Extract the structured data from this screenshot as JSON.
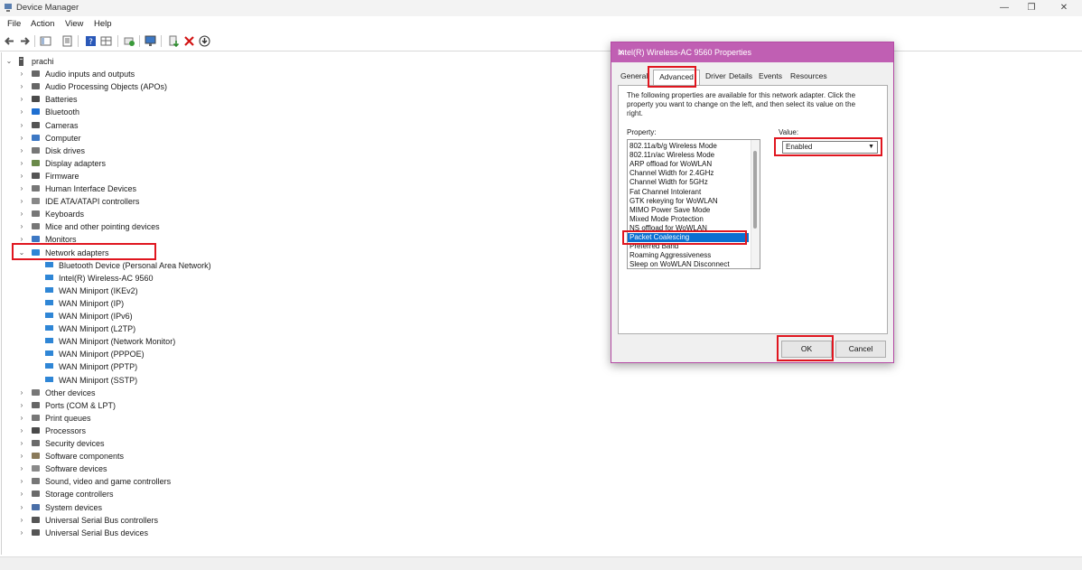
{
  "window": {
    "title": "Device Manager",
    "controls": [
      "—",
      "❐",
      "✕"
    ]
  },
  "menu": [
    "File",
    "Action",
    "View",
    "Help"
  ],
  "tree": {
    "root": "prachi",
    "categories": [
      {
        "label": "Audio inputs and outputs",
        "icon": "speaker-icon"
      },
      {
        "label": "Audio Processing Objects (APOs)",
        "icon": "speaker-icon"
      },
      {
        "label": "Batteries",
        "icon": "battery-icon"
      },
      {
        "label": "Bluetooth",
        "icon": "bluetooth-icon"
      },
      {
        "label": "Cameras",
        "icon": "camera-icon"
      },
      {
        "label": "Computer",
        "icon": "monitor-icon"
      },
      {
        "label": "Disk drives",
        "icon": "disk-icon"
      },
      {
        "label": "Display adapters",
        "icon": "display-adapter-icon"
      },
      {
        "label": "Firmware",
        "icon": "firmware-icon"
      },
      {
        "label": "Human Interface Devices",
        "icon": "hid-icon"
      },
      {
        "label": "IDE ATA/ATAPI controllers",
        "icon": "ide-icon"
      },
      {
        "label": "Keyboards",
        "icon": "keyboard-icon"
      },
      {
        "label": "Mice and other pointing devices",
        "icon": "mouse-icon"
      },
      {
        "label": "Monitors",
        "icon": "monitor-icon"
      },
      {
        "label": "Network adapters",
        "icon": "network-adapter-icon",
        "expanded": true,
        "children": [
          "Bluetooth Device (Personal Area Network)",
          "Intel(R) Wireless-AC 9560",
          "WAN Miniport (IKEv2)",
          "WAN Miniport (IP)",
          "WAN Miniport (IPv6)",
          "WAN Miniport (L2TP)",
          "WAN Miniport (Network Monitor)",
          "WAN Miniport (PPPOE)",
          "WAN Miniport (PPTP)",
          "WAN Miniport (SSTP)"
        ]
      },
      {
        "label": "Other devices",
        "icon": "other-devices-icon"
      },
      {
        "label": "Ports (COM & LPT)",
        "icon": "port-icon"
      },
      {
        "label": "Print queues",
        "icon": "printer-icon"
      },
      {
        "label": "Processors",
        "icon": "processor-icon"
      },
      {
        "label": "Security devices",
        "icon": "security-icon"
      },
      {
        "label": "Software components",
        "icon": "software-component-icon"
      },
      {
        "label": "Software devices",
        "icon": "software-device-icon"
      },
      {
        "label": "Sound, video and game controllers",
        "icon": "sound-icon"
      },
      {
        "label": "Storage controllers",
        "icon": "storage-icon"
      },
      {
        "label": "System devices",
        "icon": "system-device-icon"
      },
      {
        "label": "Universal Serial Bus controllers",
        "icon": "usb-icon"
      },
      {
        "label": "Universal Serial Bus devices",
        "icon": "usb-icon"
      }
    ]
  },
  "dialog": {
    "title": "Intel(R) Wireless-AC 9560 Properties",
    "close": "✕",
    "tabs": [
      "General",
      "Advanced",
      "Driver",
      "Details",
      "Events",
      "Resources"
    ],
    "active_tab": "Advanced",
    "description": "The following properties are available for this network adapter. Click the property you want to change on the left, and then select its value on the right.",
    "property_label": "Property:",
    "value_label": "Value:",
    "properties": [
      "802.11a/b/g Wireless Mode",
      "802.11n/ac Wireless Mode",
      "ARP offload for WoWLAN",
      "Channel Width for 2.4GHz",
      "Channel Width for 5GHz",
      "Fat Channel Intolerant",
      "GTK rekeying for WoWLAN",
      "MIMO Power Save Mode",
      "Mixed Mode Protection",
      "NS offload for WoWLAN",
      "Packet Coalescing",
      "Preferred Band",
      "Roaming Aggressiveness",
      "Sleep on WoWLAN Disconnect"
    ],
    "selected_property": "Packet Coalescing",
    "value": "Enabled",
    "ok": "OK",
    "cancel": "Cancel"
  },
  "colors": {
    "dialog_title": "#c05fb3",
    "highlight_border": "#e0161f",
    "selection": "#0a6fd1"
  }
}
